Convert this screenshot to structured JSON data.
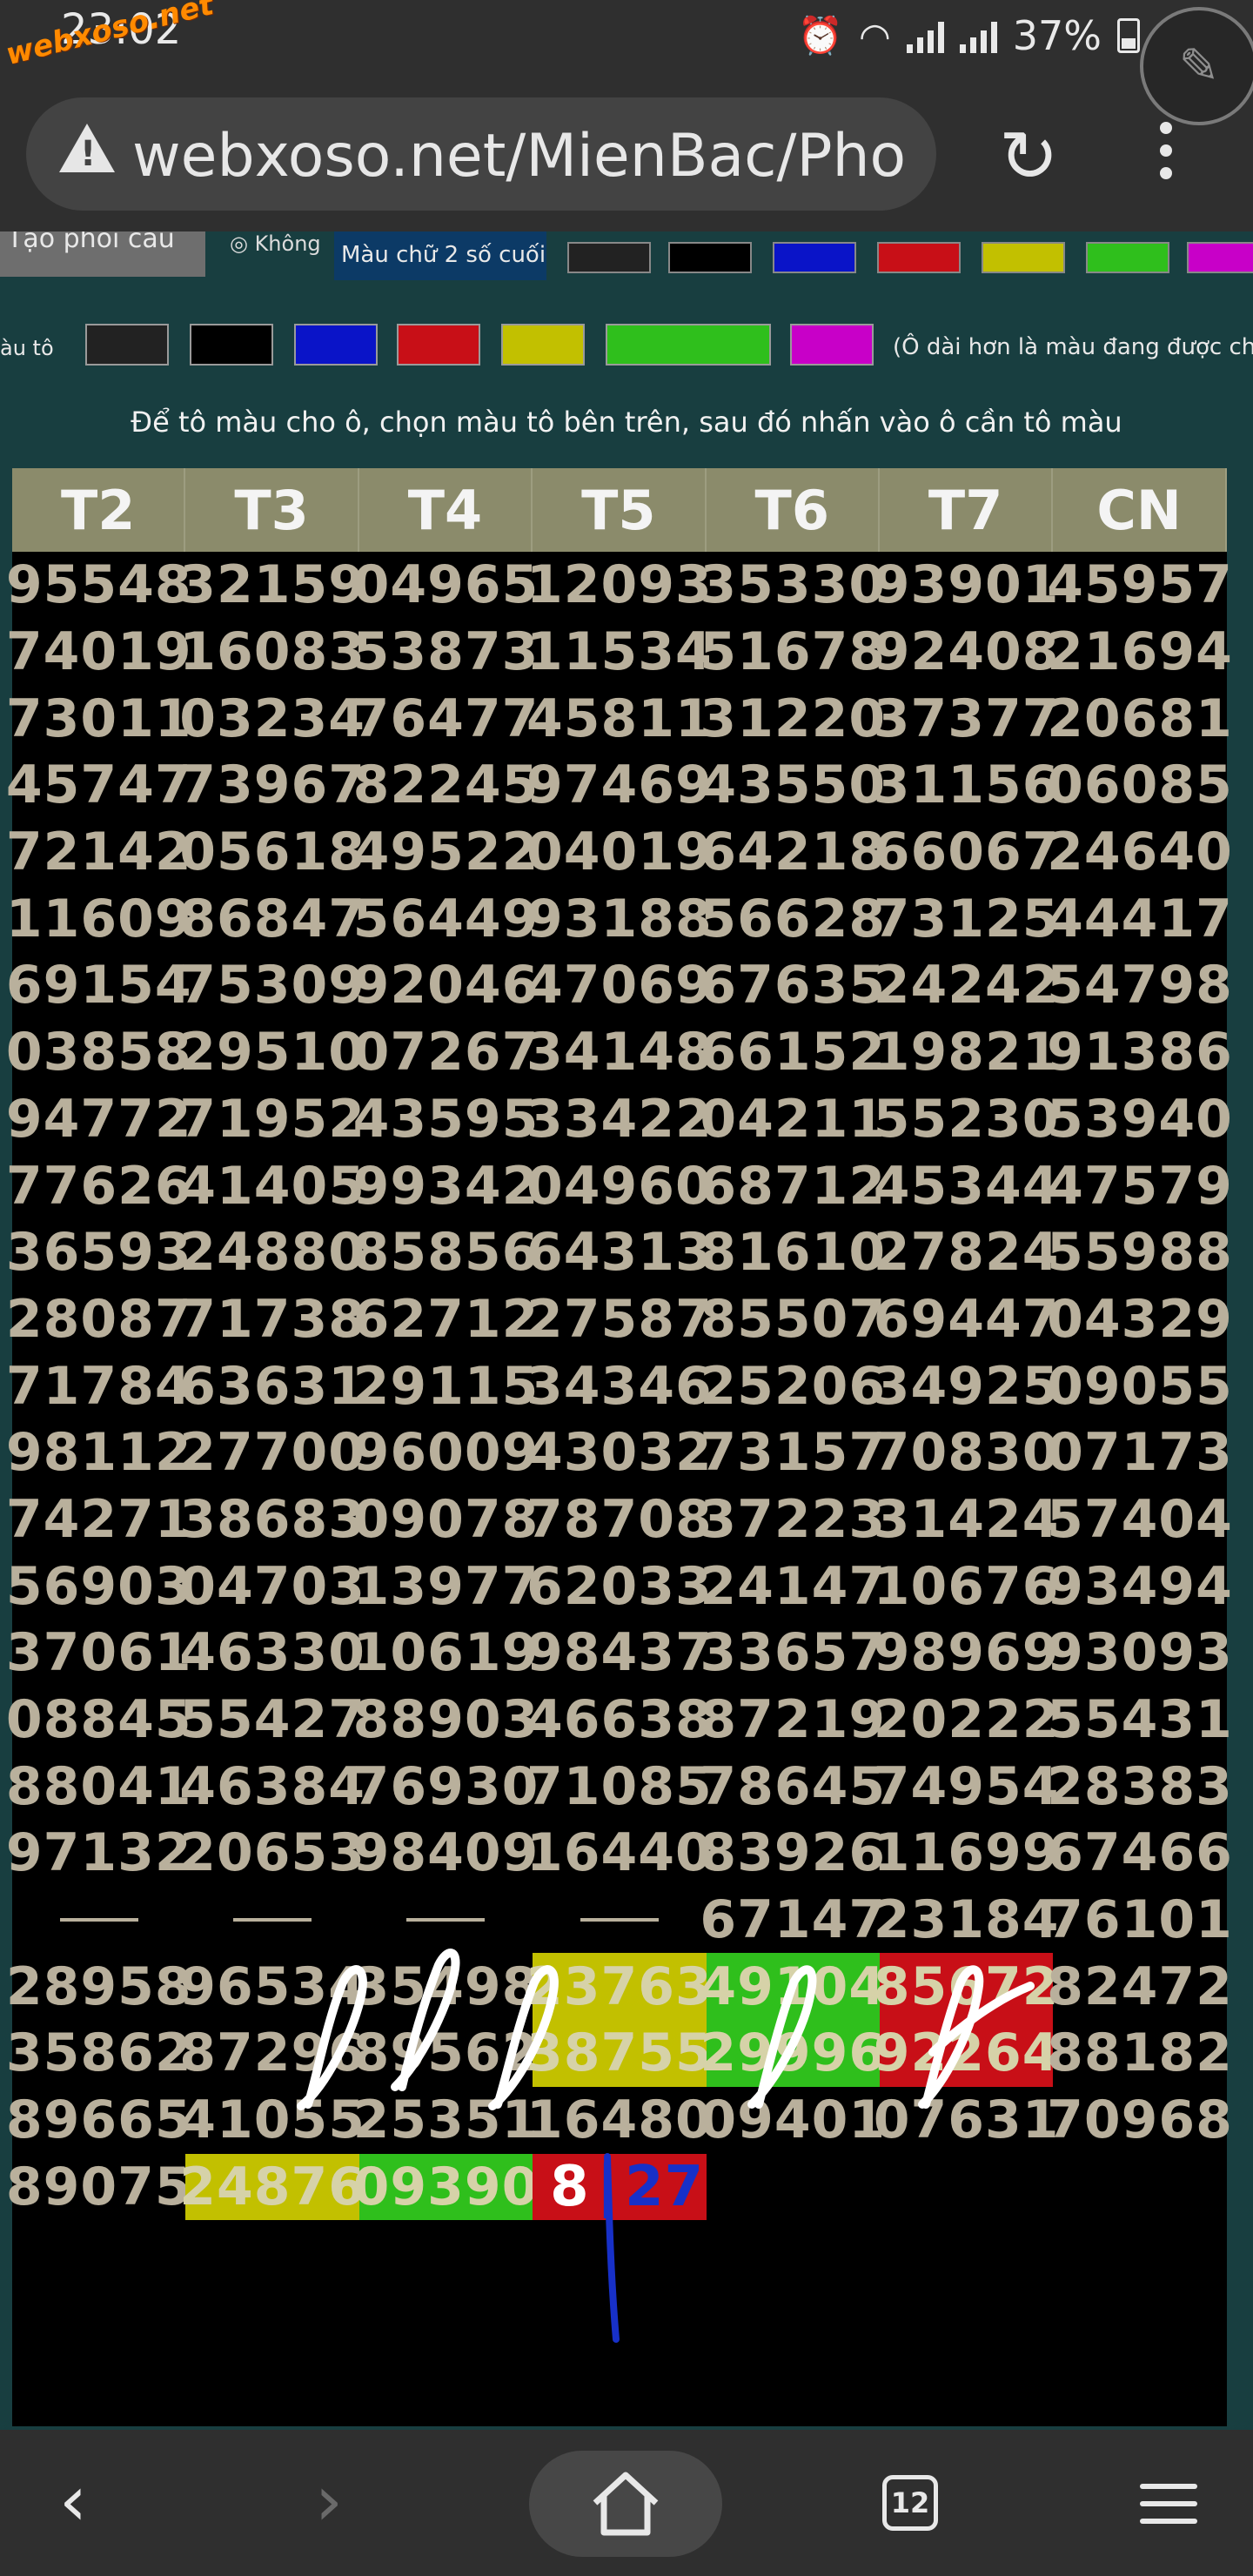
{
  "status_bar": {
    "time": "23:02",
    "watermark": "webxoso.net",
    "battery": "37%"
  },
  "address_bar": {
    "url": "webxoso.net/MienBac/Pho"
  },
  "toolbar": {
    "create_label": "Tạo phôi cầu",
    "radio_label": "◎ Không",
    "text_color_label": "Màu chữ 2 số cuối",
    "text_swatches": [
      "#222222",
      "#000000",
      "#0a14c8",
      "#c80f17",
      "#c2c000",
      "#2fbf1c",
      "#c800c8"
    ],
    "fill_label": "àu tô",
    "fill_swatches": [
      "#222222",
      "#000000",
      "#0a14c8",
      "#c80f17",
      "#c2c000",
      "#2fbf1c",
      "#c800c8"
    ],
    "fill_note": "(Ô dài hơn là màu đang được chọn)"
  },
  "hint": "Để tô màu cho ô, chọn màu tô bên trên, sau đó nhấn vào ô cần tô màu",
  "table": {
    "headers": [
      "T2",
      "T3",
      "T4",
      "T5",
      "T6",
      "T7",
      "CN"
    ],
    "rows": [
      [
        "95548",
        "32159",
        "04965",
        "12093",
        "35330",
        "93901",
        "45957"
      ],
      [
        "74019",
        "16083",
        "53873",
        "11534",
        "51678",
        "92408",
        "21694"
      ],
      [
        "73011",
        "03234",
        "76477",
        "45811",
        "31220",
        "37377",
        "20681"
      ],
      [
        "45747",
        "73967",
        "82245",
        "97469",
        "43550",
        "31156",
        "06085"
      ],
      [
        "72142",
        "05618",
        "49522",
        "04019",
        "64218",
        "66067",
        "24640"
      ],
      [
        "11609",
        "86847",
        "56449",
        "93188",
        "56628",
        "73125",
        "44417"
      ],
      [
        "69154",
        "75309",
        "92046",
        "47069",
        "67635",
        "24242",
        "54798"
      ],
      [
        "03858",
        "29510",
        "07267",
        "34148",
        "66152",
        "19821",
        "91386"
      ],
      [
        "94772",
        "71952",
        "43595",
        "33422",
        "04211",
        "55230",
        "53940"
      ],
      [
        "77626",
        "41405",
        "99342",
        "04960",
        "68712",
        "45344",
        "47579"
      ],
      [
        "36593",
        "24880",
        "85856",
        "64313",
        "81610",
        "27824",
        "55988"
      ],
      [
        "28087",
        "71738",
        "62712",
        "27587",
        "85507",
        "69447",
        "04329"
      ],
      [
        "71784",
        "63631",
        "29115",
        "34346",
        "25206",
        "34925",
        "09055"
      ],
      [
        "98112",
        "27700",
        "96009",
        "43032",
        "73157",
        "70830",
        "07173"
      ],
      [
        "74271",
        "38683",
        "09078",
        "78708",
        "37223",
        "31424",
        "57404"
      ],
      [
        "56903",
        "04703",
        "13977",
        "62033",
        "24147",
        "10676",
        "93494"
      ],
      [
        "37061",
        "46330",
        "10619",
        "98437",
        "33657",
        "98969",
        "93093"
      ],
      [
        "08845",
        "55427",
        "88903",
        "46638",
        "87219",
        "20222",
        "55431"
      ],
      [
        "88041",
        "46384",
        "76930",
        "71085",
        "78645",
        "74954",
        "28383"
      ],
      [
        "97132",
        "20653",
        "98409",
        "16440",
        "83926",
        "11699",
        "67466"
      ],
      [
        "—",
        "—",
        "—",
        "—",
        "67147",
        "23184",
        "76101"
      ],
      [
        "28958",
        "96534",
        "35498",
        "23763",
        "49104",
        "85672",
        "82472"
      ],
      [
        "35862",
        "87296",
        "89562",
        "38755",
        "29996",
        "92264",
        "88182"
      ],
      [
        "89665",
        "41055",
        "25351",
        "16480",
        "09401",
        "07631",
        "70968"
      ],
      [
        "89075",
        "24876",
        "09390",
        "8|27",
        "",
        "",
        ""
      ]
    ],
    "highlights": {
      "21": {
        "3": "yellow",
        "4": "green",
        "5": "red"
      },
      "22": {
        "3": "yellow",
        "4": "green",
        "5": "red"
      },
      "24": {
        "1": "yellow",
        "2": "green",
        "3": "red"
      }
    }
  },
  "nav": {
    "tab_count": "12"
  }
}
